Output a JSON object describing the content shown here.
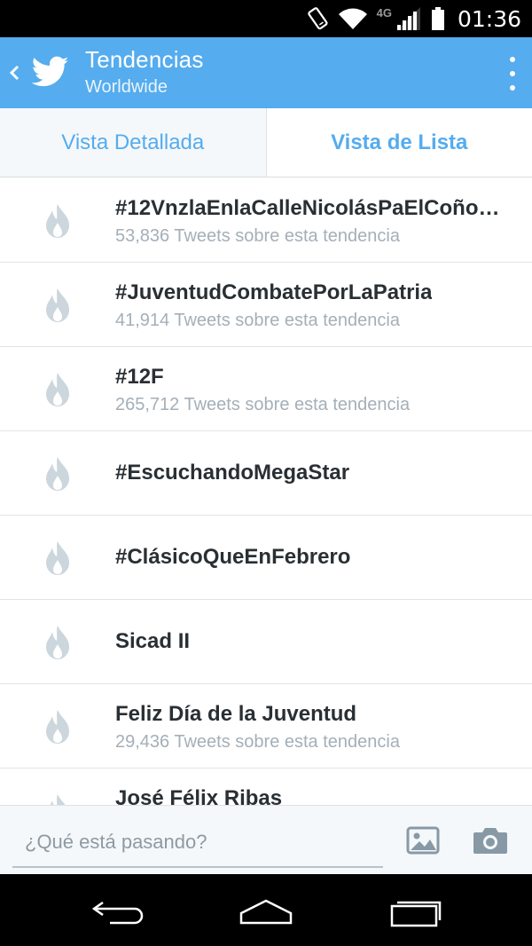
{
  "status_bar": {
    "network": "4G",
    "time": "01:36"
  },
  "app_bar": {
    "title": "Tendencias",
    "subtitle": "Worldwide",
    "accent_color": "#55acee"
  },
  "tabs": [
    {
      "label": "Vista Detallada",
      "active": false
    },
    {
      "label": "Vista de Lista",
      "active": true
    }
  ],
  "trends": [
    {
      "name": "#12VnzlaEnlaCalleNicolásPaElCoño…",
      "count": "53,836 Tweets sobre esta tendencia"
    },
    {
      "name": "#JuventudCombatePorLaPatria",
      "count": "41,914 Tweets sobre esta tendencia"
    },
    {
      "name": "#12F",
      "count": "265,712 Tweets sobre esta tendencia"
    },
    {
      "name": "#EscuchandoMegaStar",
      "count": ""
    },
    {
      "name": "#ClásicoQueEnFebrero",
      "count": ""
    },
    {
      "name": "Sicad II",
      "count": ""
    },
    {
      "name": "Feliz Día de la Juventud",
      "count": "29,436 Tweets sobre esta tendencia"
    },
    {
      "name": "José Félix Ribas",
      "count": ""
    }
  ],
  "compose": {
    "placeholder": "¿Qué está pasando?"
  },
  "icons": {
    "back": "chevron-left-icon",
    "logo": "twitter-bird-icon",
    "menu": "overflow-menu-icon",
    "trend": "flame-icon",
    "image": "image-icon",
    "camera": "camera-icon"
  }
}
